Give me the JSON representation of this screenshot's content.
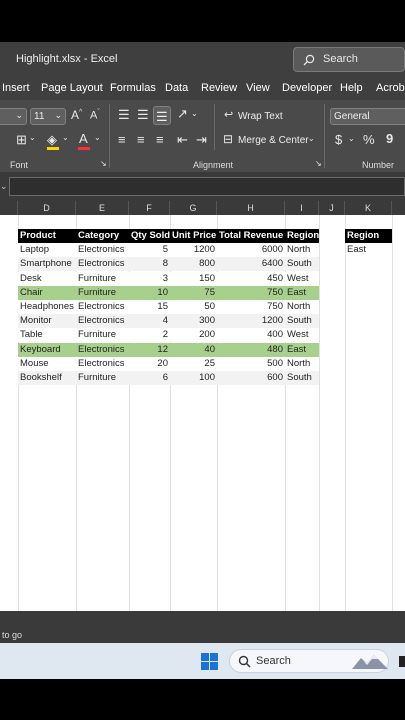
{
  "window": {
    "title": "Highlight.xlsx  -  Excel",
    "search_placeholder": "Search"
  },
  "menu": [
    "Insert",
    "Page Layout",
    "Formulas",
    "Data",
    "Review",
    "View",
    "Developer",
    "Help",
    "Acroba"
  ],
  "ribbon": {
    "font_size": "11",
    "wrap_text": "Wrap Text",
    "merge_center": "Merge & Center",
    "number_format": "General",
    "currency_symbol": "$",
    "percent_symbol": "%",
    "comma_symbol": "9",
    "groups": {
      "font": "Font",
      "alignment": "Alignment",
      "number": "Number"
    }
  },
  "columns": [
    "D",
    "E",
    "F",
    "G",
    "H",
    "I",
    "J",
    "K"
  ],
  "table": {
    "headers": [
      "Product",
      "Category",
      "Qty Sold",
      "Unit Price",
      "Total Revenue",
      "Region"
    ],
    "rows": [
      [
        "Laptop",
        "Electronics",
        "5",
        "1200",
        "6000",
        "North"
      ],
      [
        "Smartphone",
        "Electronics",
        "8",
        "800",
        "6400",
        "South"
      ],
      [
        "Desk",
        "Furniture",
        "3",
        "150",
        "450",
        "West"
      ],
      [
        "Chair",
        "Furniture",
        "10",
        "75",
        "750",
        "East"
      ],
      [
        "Headphones",
        "Electronics",
        "15",
        "50",
        "750",
        "North"
      ],
      [
        "Monitor",
        "Electronics",
        "4",
        "300",
        "1200",
        "South"
      ],
      [
        "Table",
        "Furniture",
        "2",
        "200",
        "400",
        "West"
      ],
      [
        "Keyboard",
        "Electronics",
        "12",
        "40",
        "480",
        "East"
      ],
      [
        "Mouse",
        "Electronics",
        "20",
        "25",
        "500",
        "North"
      ],
      [
        "Bookshelf",
        "Furniture",
        "6",
        "100",
        "600",
        "South"
      ]
    ],
    "highlighted_rows": [
      3,
      7
    ],
    "highlight_color": "#a8d08d",
    "stripe_color": "#f2f2f2"
  },
  "criteria": {
    "header": "Region",
    "value": "East"
  },
  "status": {
    "text": "to go"
  },
  "taskbar": {
    "search_label": "Search"
  }
}
